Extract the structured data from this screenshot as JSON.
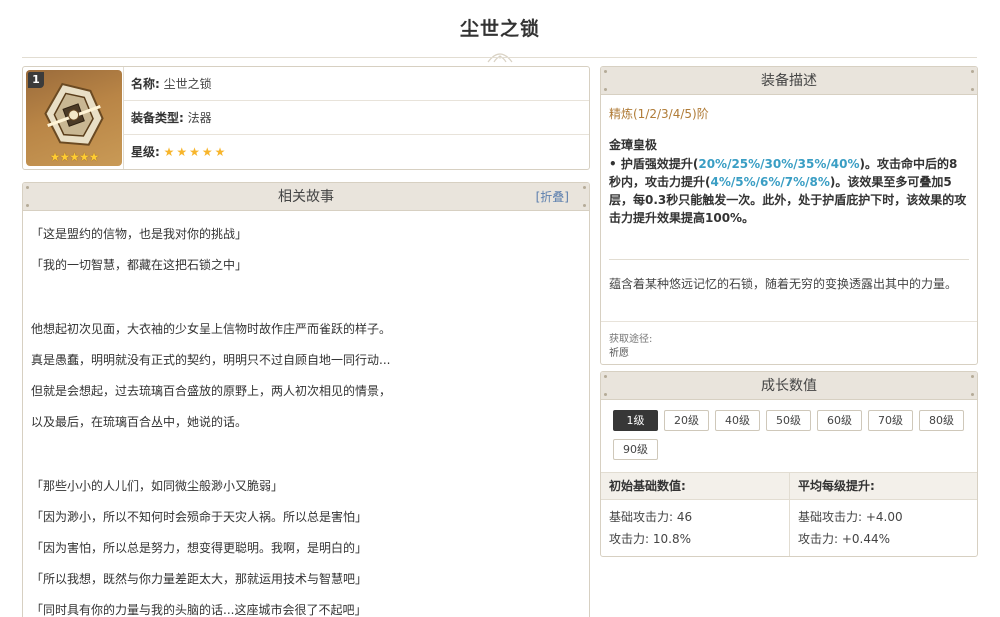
{
  "page_title": "尘世之锁",
  "info": {
    "refine_badge": "1",
    "img_stars": "★★★★★",
    "name_label": "名称:",
    "name_value": "尘世之锁",
    "type_label": "装备类型:",
    "type_value": "法器",
    "rarity_label": "星级:",
    "rarity_stars": "★★★★★"
  },
  "story": {
    "header": "相关故事",
    "fold_label": "[折叠]",
    "lines": [
      "「这是盟约的信物，也是我对你的挑战」",
      "「我的一切智慧，都藏在这把石锁之中」",
      "",
      "他想起初次见面，大衣袖的少女呈上信物时故作庄严而雀跃的样子。",
      "真是愚蠢，明明就没有正式的契约，明明只不过自顾自地一同行动...",
      "但就是会想起，过去琉璃百合盛放的原野上，两人初次相见的情景，",
      "以及最后，在琉璃百合丛中，她说的话。",
      "",
      "「那些小小的人儿们，如同微尘般渺小又脆弱」",
      "「因为渺小，所以不知何时会殒命于天灾人祸。所以总是害怕」",
      "「因为害怕，所以总是努力，想变得更聪明。我啊，是明白的」",
      "「所以我想，既然与你力量差距太大，那就运用技术与智慧吧」",
      "「同时具有你的力量与我的头脑的话...这座城市会很了不起吧」"
    ]
  },
  "desc": {
    "header": "装备描述",
    "refine_label": "精炼(1/2/3/4/5)阶",
    "passive_name": "金璋皇极",
    "passive_parts": {
      "p1": "• 护盾强效提升(",
      "v1": "20%/25%/30%/35%/40%",
      "p2": ")。攻击命中后的8秒内，攻击力提升(",
      "v2": "4%/5%/6%/7%/8%",
      "p3": ")。该效果至多可叠加5层，每0.3秒只能触发一次。此外，处于护盾庇护下时，该效果的攻击力提升效果提高100%。"
    },
    "lore": "蕴含着某种悠远记忆的石锁，随着无穷的变换透露出其中的力量。",
    "source_label": "获取途径:",
    "source_value": "祈愿"
  },
  "growth": {
    "header": "成长数值",
    "levels": [
      "1级",
      "20级",
      "40级",
      "50级",
      "60级",
      "70级",
      "80级",
      "90级"
    ],
    "base_title": "初始基础数值:",
    "per_level_title": "平均每级提升:",
    "base_stats": [
      "基础攻击力: 46",
      "攻击力: 10.8%"
    ],
    "per_level_stats": [
      "基础攻击力: +4.00",
      "攻击力: +0.44%"
    ]
  },
  "colors": {
    "header_bg": "#e9e4dc",
    "refine_text": "#b07c38",
    "highlight": "#3a9ec4",
    "active_level_bg": "#373737",
    "star": "#f7b52c"
  }
}
